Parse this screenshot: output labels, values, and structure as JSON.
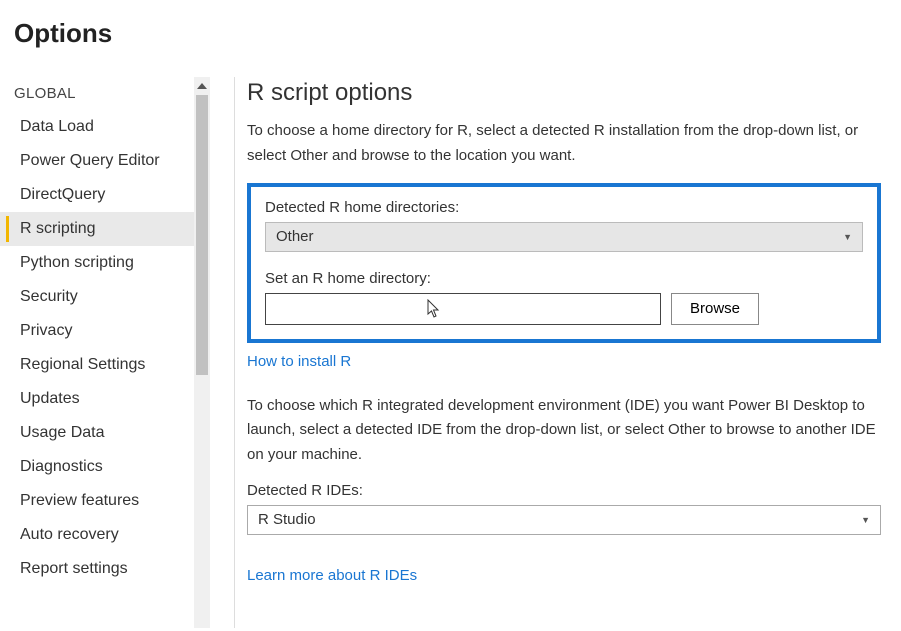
{
  "header": {
    "title": "Options"
  },
  "sidebar": {
    "heading": "GLOBAL",
    "items": [
      {
        "label": "Data Load"
      },
      {
        "label": "Power Query Editor"
      },
      {
        "label": "DirectQuery"
      },
      {
        "label": "R scripting"
      },
      {
        "label": "Python scripting"
      },
      {
        "label": "Security"
      },
      {
        "label": "Privacy"
      },
      {
        "label": "Regional Settings"
      },
      {
        "label": "Updates"
      },
      {
        "label": "Usage Data"
      },
      {
        "label": "Diagnostics"
      },
      {
        "label": "Preview features"
      },
      {
        "label": "Auto recovery"
      },
      {
        "label": "Report settings"
      }
    ],
    "active_index": 3
  },
  "content": {
    "title": "R script options",
    "intro": "To choose a home directory for R, select a detected R installation from the drop-down list, or select Other and browse to the location you want.",
    "detected_label": "Detected R home directories:",
    "detected_value": "Other",
    "set_home_label": "Set an R home directory:",
    "home_path_value": "",
    "browse_label": "Browse",
    "install_link": "How to install R",
    "ide_intro": "To choose which R integrated development environment (IDE) you want Power BI Desktop to launch, select a detected IDE from the drop-down list, or select Other to browse to another IDE on your machine.",
    "ide_label": "Detected R IDEs:",
    "ide_value": "R Studio",
    "ide_link": "Learn more about R IDEs"
  }
}
